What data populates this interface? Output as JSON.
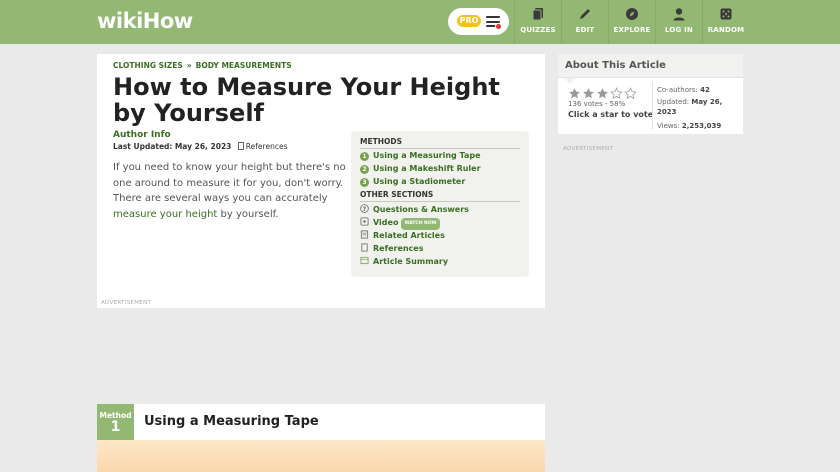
{
  "header": {
    "logo_wiki": "wiki",
    "logo_how": "How",
    "pro_label": "PRO",
    "nav": [
      {
        "label": "QUIZZES",
        "icon": "quiz-icon"
      },
      {
        "label": "EDIT",
        "icon": "pencil-icon"
      },
      {
        "label": "EXPLORE",
        "icon": "compass-icon"
      },
      {
        "label": "LOG IN",
        "icon": "user-icon"
      },
      {
        "label": "RANDOM",
        "icon": "dice-icon"
      }
    ]
  },
  "article": {
    "breadcrumbs": [
      "CLOTHING SIZES",
      "BODY MEASUREMENTS"
    ],
    "breadcrumb_sep": "»",
    "title": "How to Measure Your Height by Yourself",
    "author": "Author Info",
    "updated_label": "Last Updated:",
    "updated_date": "May 26, 2023",
    "references": "References",
    "intro_text": "If you need to know your height but there's no one around to measure it for you, don't worry. There are several ways you can accurately ",
    "intro_link": "measure your height",
    "intro_tail": " by yourself.",
    "advertisement": "ADVERTISEMENT"
  },
  "toc": {
    "methods_heading": "METHODS",
    "methods": [
      {
        "num": "1",
        "label": "Using a Measuring Tape"
      },
      {
        "num": "2",
        "label": "Using a Makeshift Ruler"
      },
      {
        "num": "3",
        "label": "Using a Stadiometer"
      }
    ],
    "other_heading": "OTHER SECTIONS",
    "other": [
      {
        "label": "Questions & Answers",
        "icon": "question-icon"
      },
      {
        "label": "Video",
        "icon": "video-icon",
        "badge": "WATCH NOW"
      },
      {
        "label": "Related Articles",
        "icon": "related-icon"
      },
      {
        "label": "References",
        "icon": "references-icon"
      },
      {
        "label": "Article Summary",
        "icon": "summary-icon"
      }
    ]
  },
  "sidebar": {
    "heading": "About This Article",
    "rating_stars": 3,
    "rating_max": 5,
    "votes": "136 votes - 58%",
    "click_star": "Click a star to vote",
    "coauthors_label": "Co-authors:",
    "coauthors": "42",
    "updated_label": "Updated:",
    "updated": "May 26, 2023",
    "views_label": "Views:",
    "views": "2,253,039",
    "advertisement": "ADVERTISEMENT"
  },
  "method": {
    "label": "Method",
    "number": "1",
    "title": "Using a Measuring Tape"
  },
  "colors": {
    "brand_green": "#93b874",
    "link_green": "#3a6e22",
    "pro_yellow": "#f5c21b"
  }
}
